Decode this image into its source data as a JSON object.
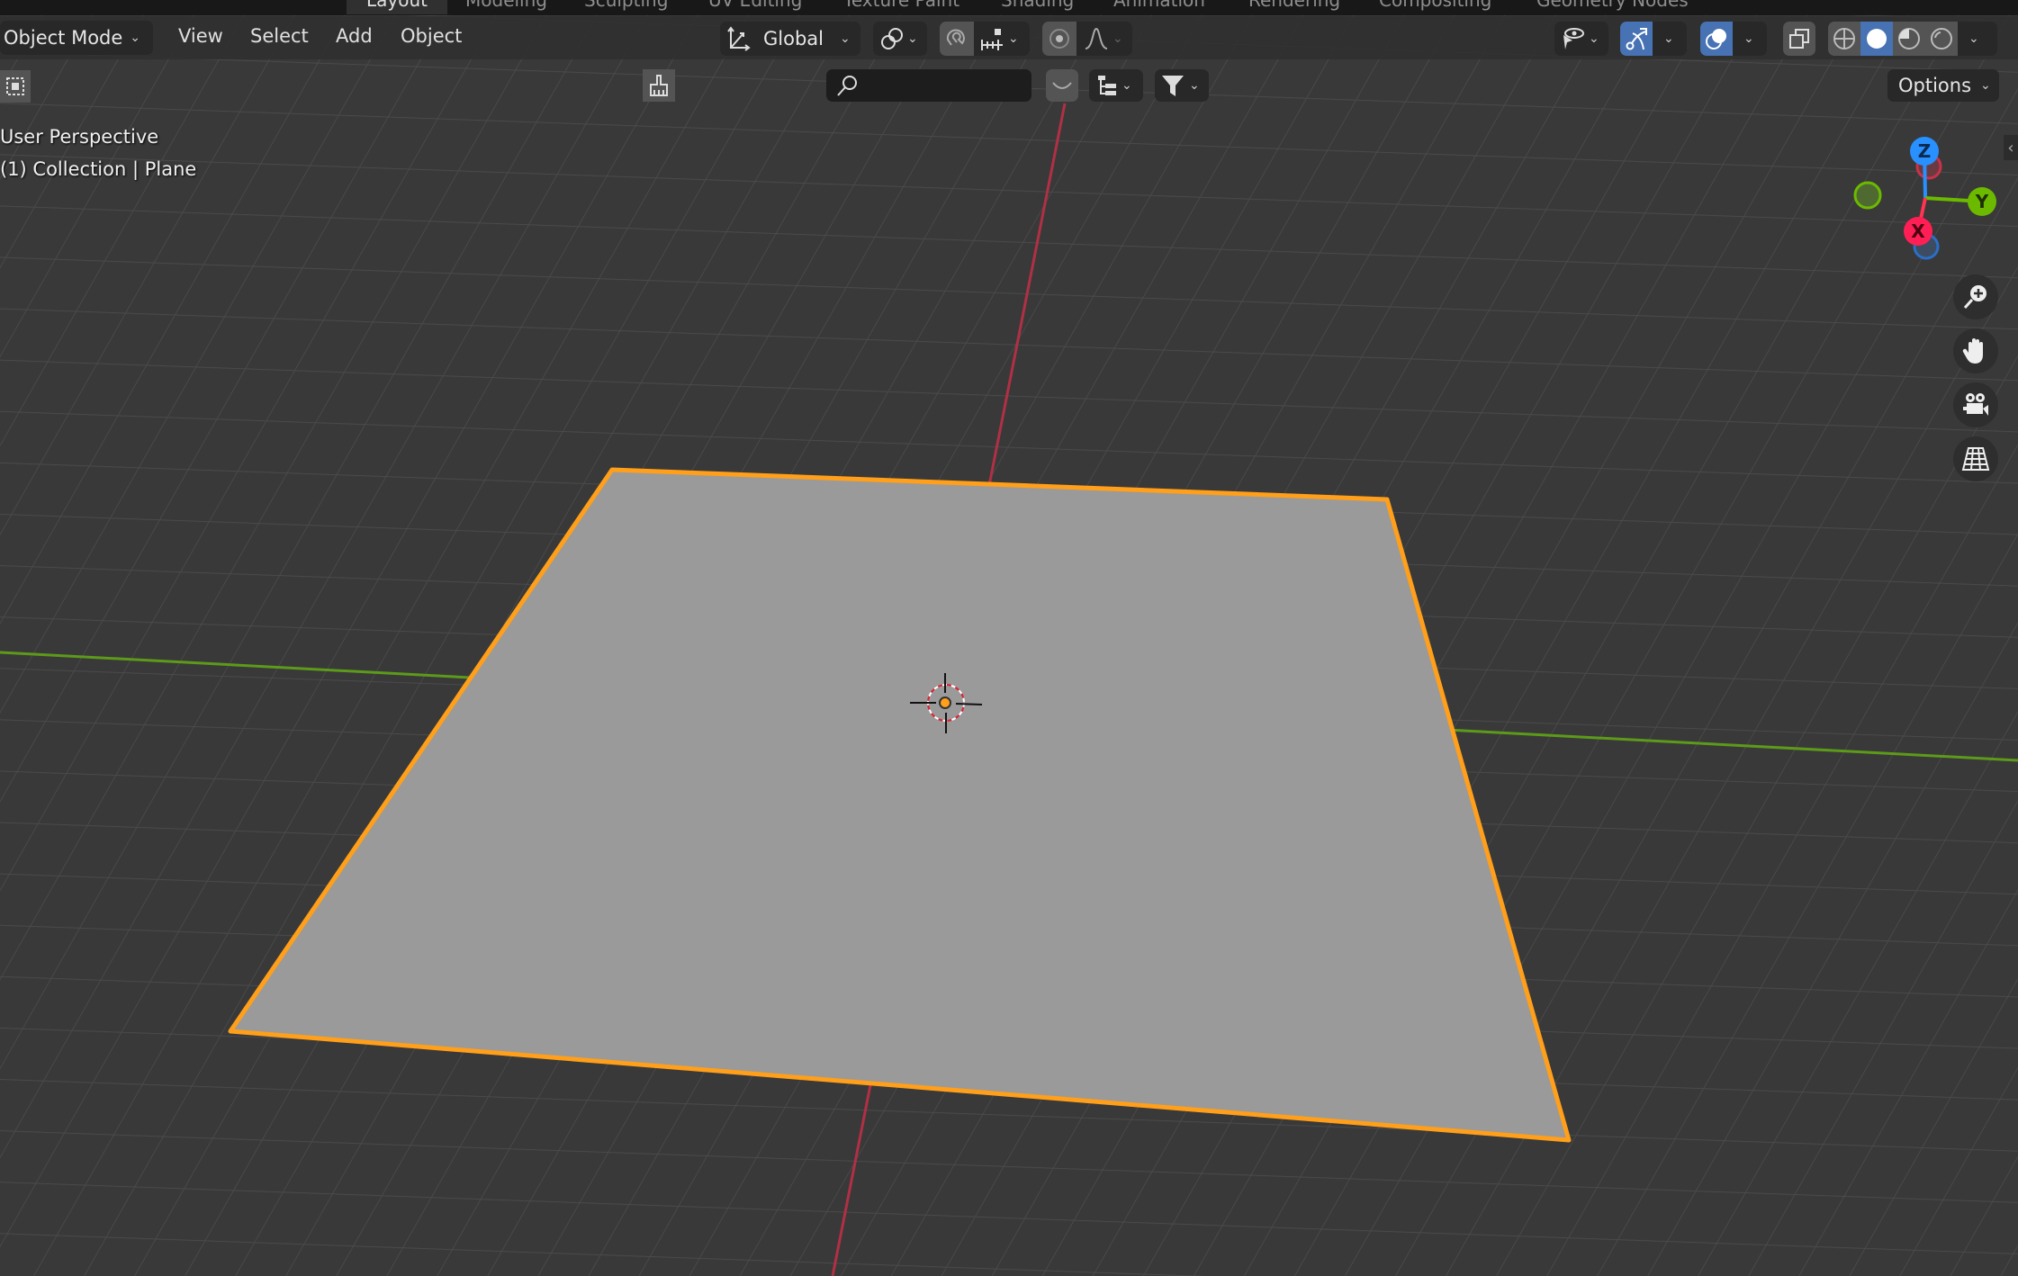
{
  "workspace_tabs": [
    {
      "label": "Layout",
      "active": true
    },
    {
      "label": "Modeling",
      "active": false
    },
    {
      "label": "Sculpting",
      "active": false
    },
    {
      "label": "UV Editing",
      "active": false
    },
    {
      "label": "Texture Paint",
      "active": false
    },
    {
      "label": "Shading",
      "active": false
    },
    {
      "label": "Animation",
      "active": false
    },
    {
      "label": "Rendering",
      "active": false
    },
    {
      "label": "Compositing",
      "active": false
    },
    {
      "label": "Geometry Nodes",
      "active": false
    }
  ],
  "header": {
    "mode": "Object Mode",
    "menus": [
      "View",
      "Select",
      "Add",
      "Object"
    ],
    "transform_orientation": "Global",
    "options_label": "Options"
  },
  "toolbar2": {
    "search_placeholder": ""
  },
  "viewport": {
    "view_name": "User Perspective",
    "collection_info": "(1) Collection | Plane",
    "selected_object": "Plane",
    "gizmo_axes": [
      "X",
      "Y",
      "Z"
    ]
  },
  "colors": {
    "selection_outline": "#ff9f1a",
    "accent_blue": "#4772b3",
    "axis_x": "#ff3352",
    "axis_y": "#8bdc00",
    "axis_z": "#2890ff",
    "plane_fill": "#9a9a9a",
    "background": "#393939"
  }
}
